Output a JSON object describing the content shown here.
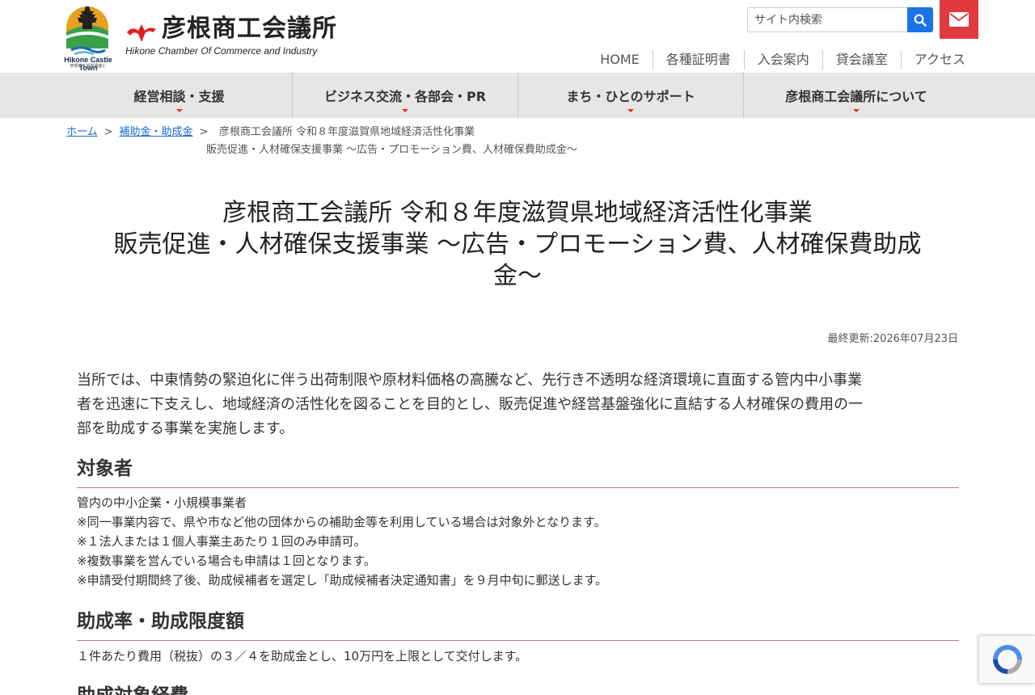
{
  "header": {
    "castle_caption": "Hikone Castle Town",
    "castle_sub": "彦根城を世界遺産に",
    "brand_name": "彦根商工会議所",
    "brand_en": "Hikone Chamber Of Commerce and Industry",
    "search_placeholder": "サイト内検索",
    "util_nav": [
      "HOME",
      "各種証明書",
      "入会案内",
      "貸会議室",
      "アクセス"
    ]
  },
  "global_nav": [
    "経営相談・支援",
    "ビジネス交流・各部会・PR",
    "まち・ひとのサポート",
    "彦根商工会議所について"
  ],
  "breadcrumb": {
    "home": "ホーム",
    "sep": ">",
    "parent": "補助金・助成金",
    "current_line1": "彦根商工会議所 令和８年度滋賀県地域経済活性化事業",
    "current_line2": "販売促進・人材確保支援事業 ～広告・プロモーション費、人材確保費助成金～"
  },
  "page": {
    "title_line1": "彦根商工会議所 令和８年度滋賀県地域経済活性化事業",
    "title_line2": "販売促進・人材確保支援事業 ～広告・プロモーション費、人材確保費助成",
    "title_line3": "金～",
    "updated": "最終更新:2026年07月23日",
    "intro_line1": "当所では、中東情勢の緊迫化に伴う出荷制限や原材料価格の高騰など、先行き不透明な経済環境に直面する管内中小事業",
    "intro_line2": "者を迅速に下支えし、地域経済の活性化を図ることを目的とし、販売促進や経営基盤強化に直結する人材確保の費用の一",
    "intro_line3": "部を助成する事業を実施します。"
  },
  "sections": {
    "target": {
      "heading": "対象者",
      "lines": [
        "管内の中小企業・小規模事業者",
        "※同一事業内容で、県や市など他の団体からの補助金等を利用している場合は対象外となります。",
        "※１法人または１個人事業主あたり１回のみ申請可。",
        "※複数事業を営んでいる場合も申請は１回となります。",
        "※申請受付期間終了後、助成候補者を選定し「助成候補者決定通知書」を９月中旬に郵送します。"
      ]
    },
    "rate": {
      "heading": "助成率・助成限度額",
      "lines": [
        "１件あたり費用（税抜）の３／４を助成金とし、10万円を上限として交付します。"
      ]
    },
    "expenses": {
      "heading": "助成対象経費"
    }
  },
  "colors": {
    "nav_bg": "#e6e6e6",
    "search_btn": "#1a73e8",
    "mail_btn": "#e03a3e",
    "brand_red": "#e02020",
    "heading_rule": "#c47a7a",
    "link": "#1a6bcc"
  },
  "icons": {
    "search": "search-icon",
    "mail": "envelope-icon",
    "recaptcha": "recaptcha-icon"
  }
}
